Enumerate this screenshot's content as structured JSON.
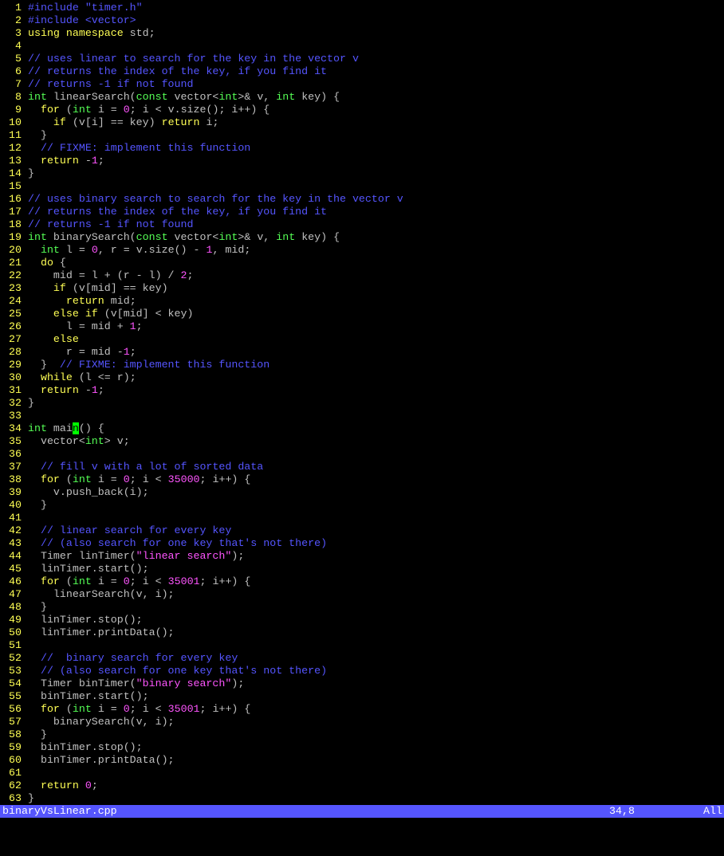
{
  "colors": {
    "background": "#000000",
    "line_number": "#ffff54",
    "normal": "#c0c0c0",
    "preprocessor": "#5555ff",
    "keyword": "#ffff55",
    "type": "#55ff55",
    "string": "#ff55ff",
    "number": "#ff55ff",
    "comment": "#5555ff",
    "cursor_bg": "#00ff00",
    "statusline_bg": "#5555ff",
    "statusline_fg": "#ffffff"
  },
  "lines": [
    {
      "n": "1",
      "tokens": [
        [
          "preproc",
          "#include \"timer.h\""
        ]
      ]
    },
    {
      "n": "2",
      "tokens": [
        [
          "preproc",
          "#include <vector>"
        ]
      ]
    },
    {
      "n": "3",
      "tokens": [
        [
          "keyword",
          "using namespace"
        ],
        [
          "normal",
          " std;"
        ]
      ]
    },
    {
      "n": "4",
      "tokens": []
    },
    {
      "n": "5",
      "tokens": [
        [
          "comment",
          "// uses linear to search for the key in the vector v"
        ]
      ]
    },
    {
      "n": "6",
      "tokens": [
        [
          "comment",
          "// returns the index of the key, if you find it"
        ]
      ]
    },
    {
      "n": "7",
      "tokens": [
        [
          "comment",
          "// returns -1 if not found"
        ]
      ]
    },
    {
      "n": "8",
      "tokens": [
        [
          "type",
          "int"
        ],
        [
          "normal",
          " linearSearch("
        ],
        [
          "type",
          "const"
        ],
        [
          "normal",
          " vector<"
        ],
        [
          "type",
          "int"
        ],
        [
          "normal",
          ">& v, "
        ],
        [
          "type",
          "int"
        ],
        [
          "normal",
          " key) {"
        ]
      ]
    },
    {
      "n": "9",
      "tokens": [
        [
          "normal",
          "  "
        ],
        [
          "keyword",
          "for"
        ],
        [
          "normal",
          " ("
        ],
        [
          "type",
          "int"
        ],
        [
          "normal",
          " i = "
        ],
        [
          "number",
          "0"
        ],
        [
          "normal",
          "; i < v.size(); i++) {"
        ]
      ]
    },
    {
      "n": "10",
      "tokens": [
        [
          "normal",
          "    "
        ],
        [
          "keyword",
          "if"
        ],
        [
          "normal",
          " (v[i] == key) "
        ],
        [
          "keyword",
          "return"
        ],
        [
          "normal",
          " i;"
        ]
      ]
    },
    {
      "n": "11",
      "tokens": [
        [
          "normal",
          "  }"
        ]
      ]
    },
    {
      "n": "12",
      "tokens": [
        [
          "normal",
          "  "
        ],
        [
          "comment",
          "// FIXME: implement this function"
        ]
      ]
    },
    {
      "n": "13",
      "tokens": [
        [
          "normal",
          "  "
        ],
        [
          "keyword",
          "return"
        ],
        [
          "normal",
          " -"
        ],
        [
          "number",
          "1"
        ],
        [
          "normal",
          ";"
        ]
      ]
    },
    {
      "n": "14",
      "tokens": [
        [
          "normal",
          "}"
        ]
      ]
    },
    {
      "n": "15",
      "tokens": []
    },
    {
      "n": "16",
      "tokens": [
        [
          "comment",
          "// uses binary search to search for the key in the vector v"
        ]
      ]
    },
    {
      "n": "17",
      "tokens": [
        [
          "comment",
          "// returns the index of the key, if you find it"
        ]
      ]
    },
    {
      "n": "18",
      "tokens": [
        [
          "comment",
          "// returns -1 if not found"
        ]
      ]
    },
    {
      "n": "19",
      "tokens": [
        [
          "type",
          "int"
        ],
        [
          "normal",
          " binarySearch("
        ],
        [
          "type",
          "const"
        ],
        [
          "normal",
          " vector<"
        ],
        [
          "type",
          "int"
        ],
        [
          "normal",
          ">& v, "
        ],
        [
          "type",
          "int"
        ],
        [
          "normal",
          " key) {"
        ]
      ]
    },
    {
      "n": "20",
      "tokens": [
        [
          "normal",
          "  "
        ],
        [
          "type",
          "int"
        ],
        [
          "normal",
          " l = "
        ],
        [
          "number",
          "0"
        ],
        [
          "normal",
          ", r = v.size() - "
        ],
        [
          "number",
          "1"
        ],
        [
          "normal",
          ", mid;"
        ]
      ]
    },
    {
      "n": "21",
      "tokens": [
        [
          "normal",
          "  "
        ],
        [
          "keyword",
          "do"
        ],
        [
          "normal",
          " {"
        ]
      ]
    },
    {
      "n": "22",
      "tokens": [
        [
          "normal",
          "    mid = l + (r - l) / "
        ],
        [
          "number",
          "2"
        ],
        [
          "normal",
          ";"
        ]
      ]
    },
    {
      "n": "23",
      "tokens": [
        [
          "normal",
          "    "
        ],
        [
          "keyword",
          "if"
        ],
        [
          "normal",
          " (v[mid] == key)"
        ]
      ]
    },
    {
      "n": "24",
      "tokens": [
        [
          "normal",
          "      "
        ],
        [
          "keyword",
          "return"
        ],
        [
          "normal",
          " mid;"
        ]
      ]
    },
    {
      "n": "25",
      "tokens": [
        [
          "normal",
          "    "
        ],
        [
          "keyword",
          "else if"
        ],
        [
          "normal",
          " (v[mid] < key)"
        ]
      ]
    },
    {
      "n": "26",
      "tokens": [
        [
          "normal",
          "      l = mid + "
        ],
        [
          "number",
          "1"
        ],
        [
          "normal",
          ";"
        ]
      ]
    },
    {
      "n": "27",
      "tokens": [
        [
          "normal",
          "    "
        ],
        [
          "keyword",
          "else"
        ]
      ]
    },
    {
      "n": "28",
      "tokens": [
        [
          "normal",
          "      r = mid -"
        ],
        [
          "number",
          "1"
        ],
        [
          "normal",
          ";"
        ]
      ]
    },
    {
      "n": "29",
      "tokens": [
        [
          "normal",
          "  }  "
        ],
        [
          "comment",
          "// FIXME: implement this function"
        ]
      ]
    },
    {
      "n": "30",
      "tokens": [
        [
          "normal",
          "  "
        ],
        [
          "keyword",
          "while"
        ],
        [
          "normal",
          " (l <= r);"
        ]
      ]
    },
    {
      "n": "31",
      "tokens": [
        [
          "normal",
          "  "
        ],
        [
          "keyword",
          "return"
        ],
        [
          "normal",
          " -"
        ],
        [
          "number",
          "1"
        ],
        [
          "normal",
          ";"
        ]
      ]
    },
    {
      "n": "32",
      "tokens": [
        [
          "normal",
          "}"
        ]
      ]
    },
    {
      "n": "33",
      "tokens": []
    },
    {
      "n": "34",
      "tokens": [
        [
          "type",
          "int"
        ],
        [
          "normal",
          " mai"
        ],
        [
          "cursor",
          "n"
        ],
        [
          "normal",
          "() {"
        ]
      ]
    },
    {
      "n": "35",
      "tokens": [
        [
          "normal",
          "  vector<"
        ],
        [
          "type",
          "int"
        ],
        [
          "normal",
          "> v;"
        ]
      ]
    },
    {
      "n": "36",
      "tokens": []
    },
    {
      "n": "37",
      "tokens": [
        [
          "normal",
          "  "
        ],
        [
          "comment",
          "// fill v with a lot of sorted data"
        ]
      ]
    },
    {
      "n": "38",
      "tokens": [
        [
          "normal",
          "  "
        ],
        [
          "keyword",
          "for"
        ],
        [
          "normal",
          " ("
        ],
        [
          "type",
          "int"
        ],
        [
          "normal",
          " i = "
        ],
        [
          "number",
          "0"
        ],
        [
          "normal",
          "; i < "
        ],
        [
          "number",
          "35000"
        ],
        [
          "normal",
          "; i++) {"
        ]
      ]
    },
    {
      "n": "39",
      "tokens": [
        [
          "normal",
          "    v.push_back(i);"
        ]
      ]
    },
    {
      "n": "40",
      "tokens": [
        [
          "normal",
          "  }"
        ]
      ]
    },
    {
      "n": "41",
      "tokens": []
    },
    {
      "n": "42",
      "tokens": [
        [
          "normal",
          "  "
        ],
        [
          "comment",
          "// linear search for every key"
        ]
      ]
    },
    {
      "n": "43",
      "tokens": [
        [
          "normal",
          "  "
        ],
        [
          "comment",
          "// (also search for one key that's not there)"
        ]
      ]
    },
    {
      "n": "44",
      "tokens": [
        [
          "normal",
          "  Timer linTimer("
        ],
        [
          "string",
          "\"linear search\""
        ],
        [
          "normal",
          ");"
        ]
      ]
    },
    {
      "n": "45",
      "tokens": [
        [
          "normal",
          "  linTimer.start();"
        ]
      ]
    },
    {
      "n": "46",
      "tokens": [
        [
          "normal",
          "  "
        ],
        [
          "keyword",
          "for"
        ],
        [
          "normal",
          " ("
        ],
        [
          "type",
          "int"
        ],
        [
          "normal",
          " i = "
        ],
        [
          "number",
          "0"
        ],
        [
          "normal",
          "; i < "
        ],
        [
          "number",
          "35001"
        ],
        [
          "normal",
          "; i++) {"
        ]
      ]
    },
    {
      "n": "47",
      "tokens": [
        [
          "normal",
          "    linearSearch(v, i);"
        ]
      ]
    },
    {
      "n": "48",
      "tokens": [
        [
          "normal",
          "  }"
        ]
      ]
    },
    {
      "n": "49",
      "tokens": [
        [
          "normal",
          "  linTimer.stop();"
        ]
      ]
    },
    {
      "n": "50",
      "tokens": [
        [
          "normal",
          "  linTimer.printData();"
        ]
      ]
    },
    {
      "n": "51",
      "tokens": []
    },
    {
      "n": "52",
      "tokens": [
        [
          "normal",
          "  "
        ],
        [
          "comment",
          "//  binary search for every key"
        ]
      ]
    },
    {
      "n": "53",
      "tokens": [
        [
          "normal",
          "  "
        ],
        [
          "comment",
          "// (also search for one key that's not there)"
        ]
      ]
    },
    {
      "n": "54",
      "tokens": [
        [
          "normal",
          "  Timer binTimer("
        ],
        [
          "string",
          "\"binary search\""
        ],
        [
          "normal",
          ");"
        ]
      ]
    },
    {
      "n": "55",
      "tokens": [
        [
          "normal",
          "  binTimer.start();"
        ]
      ]
    },
    {
      "n": "56",
      "tokens": [
        [
          "normal",
          "  "
        ],
        [
          "keyword",
          "for"
        ],
        [
          "normal",
          " ("
        ],
        [
          "type",
          "int"
        ],
        [
          "normal",
          " i = "
        ],
        [
          "number",
          "0"
        ],
        [
          "normal",
          "; i < "
        ],
        [
          "number",
          "35001"
        ],
        [
          "normal",
          "; i++) {"
        ]
      ]
    },
    {
      "n": "57",
      "tokens": [
        [
          "normal",
          "    binarySearch(v, i);"
        ]
      ]
    },
    {
      "n": "58",
      "tokens": [
        [
          "normal",
          "  }"
        ]
      ]
    },
    {
      "n": "59",
      "tokens": [
        [
          "normal",
          "  binTimer.stop();"
        ]
      ]
    },
    {
      "n": "60",
      "tokens": [
        [
          "normal",
          "  binTimer.printData();"
        ]
      ]
    },
    {
      "n": "61",
      "tokens": []
    },
    {
      "n": "62",
      "tokens": [
        [
          "normal",
          "  "
        ],
        [
          "keyword",
          "return"
        ],
        [
          "normal",
          " "
        ],
        [
          "number",
          "0"
        ],
        [
          "normal",
          ";"
        ]
      ]
    },
    {
      "n": "63",
      "tokens": [
        [
          "normal",
          "}"
        ]
      ]
    }
  ],
  "statusline": {
    "filename": "binaryVsLinear.cpp",
    "cursor_position": "34,8",
    "scroll_indicator": "All"
  }
}
